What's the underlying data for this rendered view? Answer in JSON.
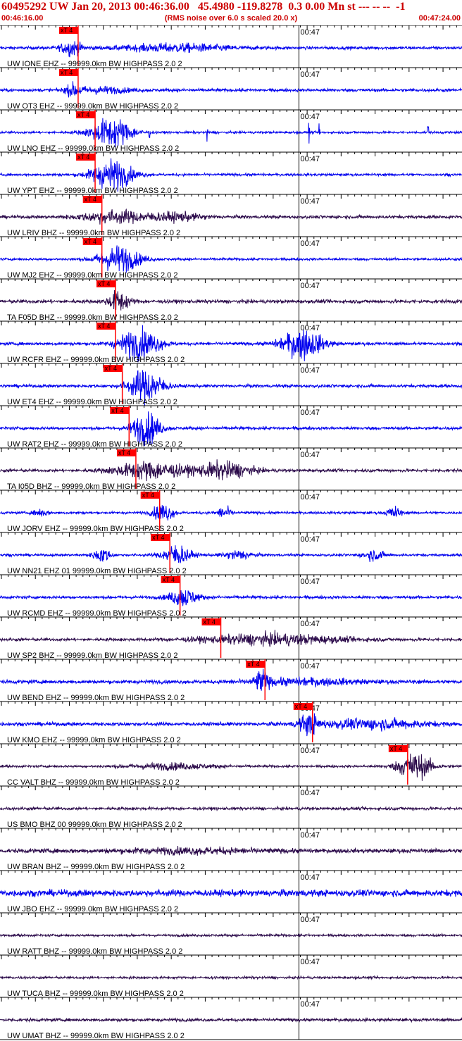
{
  "header": {
    "title": "60495292 UW Jan 20, 2013 00:46:36.00   45.4980 -119.8278  0.3 0.00 Mn st --- -- --  -1",
    "start_time": "00:46:16.00",
    "subtitle": "(RMS noise over 6.0 s scaled 20.0 x)",
    "end_time": "00:47:24.00"
  },
  "colors": {
    "header_text": "#cc0000",
    "trace_blue": "#0000ee",
    "trace_dark": "#2b0a4a",
    "pick": "#ff0000",
    "axis": "#000000"
  },
  "chart_data": {
    "type": "line",
    "x_range_seconds": [
      0,
      68
    ],
    "minute_mark_label": "00:47",
    "minute_mark_second": 44,
    "pick_label": "xT 4",
    "traces": [
      {
        "label": "UW IONE EHZ -- 99999.0km BW  HIGHPASS  2.0  2",
        "color": "blue",
        "pick_s": 11.5,
        "bursts": [
          [
            10.5,
            1.5,
            0.5
          ],
          [
            26,
            8,
            0.25
          ]
        ],
        "noise": 0.1
      },
      {
        "label": "UW OT3 EHZ -- 99999.0km BW  HIGHPASS  2.0  2",
        "color": "blue",
        "pick_s": 11.5,
        "bursts": [
          [
            10.8,
            1.2,
            0.35
          ],
          [
            15,
            4,
            0.2
          ]
        ],
        "noise": 0.1
      },
      {
        "label": "UW LNO EHZ -- 99999.0km BW  HIGHPASS  2.0  2",
        "color": "blue",
        "pick_s": 14.0,
        "bursts": [
          [
            16.5,
            3.0,
            1.0
          ]
        ],
        "noise": 0.08,
        "spikes": [
          22,
          30.5,
          45.5,
          47,
          63
        ]
      },
      {
        "label": "UW YPT EHZ -- 99999.0km BW  HIGHPASS  2.0  2",
        "color": "blue",
        "pick_s": 14.0,
        "bursts": [
          [
            16.5,
            3.0,
            1.0
          ]
        ],
        "noise": 0.08
      },
      {
        "label": "UW LRIV BHZ -- 99999.0km BW  HIGHPASS  2.0  2",
        "color": "dark",
        "pick_s": 15.0,
        "bursts": [
          [
            17,
            5,
            0.4
          ],
          [
            26,
            4,
            0.25
          ]
        ],
        "noise": 0.1
      },
      {
        "label": "UW MJ2 EHZ -- 99999.0km BW  HIGHPASS  2.0  2",
        "color": "blue",
        "pick_s": 15.0,
        "bursts": [
          [
            17.5,
            3.0,
            0.9
          ]
        ],
        "noise": 0.08
      },
      {
        "label": "TA F05D BHZ -- 99999.0km BW  HIGHPASS  2.0  2",
        "color": "dark",
        "pick_s": 17.0,
        "bursts": [
          [
            17.5,
            1.5,
            0.7
          ]
        ],
        "noise": 0.12
      },
      {
        "label": "UW RCFR EHZ -- 99999.0km BW  HIGHPASS  2.0  2",
        "color": "blue",
        "pick_s": 17.0,
        "bursts": [
          [
            20.5,
            3.0,
            1.0
          ],
          [
            44.5,
            3.0,
            1.0
          ]
        ],
        "noise": 0.1
      },
      {
        "label": "UW ET4 EHZ -- 99999.0km BW  HIGHPASS  2.0  2",
        "color": "blue",
        "pick_s": 18.0,
        "bursts": [
          [
            21.5,
            2.5,
            1.1
          ]
        ],
        "noise": 0.1
      },
      {
        "label": "UW RAT2 EHZ -- 99999.0km BW  HIGHPASS  2.0  2",
        "color": "blue",
        "pick_s": 19.0,
        "bursts": [
          [
            21.5,
            2.0,
            1.1
          ]
        ],
        "noise": 0.1
      },
      {
        "label": "TA I05D BHZ -- 99999.0km BW  HIGHPASS  2.0  2",
        "color": "dark",
        "pick_s": 20.0,
        "bursts": [
          [
            22,
            5,
            0.6
          ],
          [
            33,
            4,
            0.55
          ]
        ],
        "noise": 0.1
      },
      {
        "label": "UW JORV EHZ -- 99999.0km BW  HIGHPASS  2.0  2",
        "color": "blue",
        "pick_s": 23.5,
        "bursts": [
          [
            24,
            1.5,
            0.6
          ],
          [
            33,
            1,
            0.4
          ],
          [
            58,
            1,
            0.4
          ],
          [
            6,
            1,
            0.25
          ]
        ],
        "noise": 0.08
      },
      {
        "label": "UW NN21 EHZ 01 99999.0km BW  HIGHPASS  2.0  2",
        "color": "blue",
        "pick_s": 25.0,
        "bursts": [
          [
            26,
            2,
            0.7
          ],
          [
            15,
            1.2,
            0.5
          ],
          [
            35,
            2,
            0.3
          ],
          [
            55,
            1.5,
            0.35
          ]
        ],
        "noise": 0.08
      },
      {
        "label": "UW RCMD EHZ -- 99999.0km BW  HIGHPASS  2.0  2",
        "color": "blue",
        "pick_s": 26.5,
        "bursts": [
          [
            27,
            2,
            0.6
          ]
        ],
        "noise": 0.1
      },
      {
        "label": "UW SP2 BHZ -- 99999.0km BW  HIGHPASS  2.0  2",
        "color": "dark",
        "pick_s": 32.5,
        "bursts": [
          [
            40,
            10,
            0.35
          ]
        ],
        "noise": 0.1
      },
      {
        "label": "UW BEND EHZ -- 99999.0km BW  HIGHPASS  2.0  2",
        "color": "blue",
        "pick_s": 39.0,
        "bursts": [
          [
            38.5,
            1,
            0.7
          ],
          [
            45,
            8,
            0.2
          ]
        ],
        "noise": 0.12
      },
      {
        "label": "UW KMO EHZ -- 99999.0km BW  HIGHPASS  2.0  2",
        "color": "blue",
        "pick_s": 46.0,
        "bursts": [
          [
            45.5,
            1.5,
            0.6
          ],
          [
            55,
            8,
            0.3
          ]
        ],
        "noise": 0.12
      },
      {
        "label": "CC VALT BHZ -- 99999.0km BW  HIGHPASS  2.0  2",
        "color": "dark",
        "pick_s": 60.0,
        "bursts": [
          [
            61,
            2.5,
            0.9
          ],
          [
            25,
            6,
            0.2
          ]
        ],
        "noise": 0.08
      },
      {
        "label": "US BMO BHZ 00 99999.0km BW  HIGHPASS  2.0  2",
        "color": "dark",
        "bursts": [],
        "noise": 0.1
      },
      {
        "label": "UW BRAN BHZ -- 99999.0km BW  HIGHPASS  2.0  2",
        "color": "dark",
        "bursts": [
          [
            28,
            10,
            0.15
          ]
        ],
        "noise": 0.14
      },
      {
        "label": "UW JBO EHZ -- 99999.0km BW  HIGHPASS  2.0  2",
        "color": "blue",
        "bursts": [],
        "noise": 0.22
      },
      {
        "label": "UW RATT BHZ -- 99999.0km BW  HIGHPASS  2.0  2",
        "color": "dark",
        "bursts": [],
        "noise": 0.08
      },
      {
        "label": "UW TUCA BHZ -- 99999.0km BW  HIGHPASS  2.0  2",
        "color": "dark",
        "bursts": [],
        "noise": 0.08
      },
      {
        "label": "UW UMAT BHZ -- 99999.0km BW  HIGHPASS  2.0  2",
        "color": "dark",
        "bursts": [],
        "noise": 0.1
      }
    ]
  }
}
